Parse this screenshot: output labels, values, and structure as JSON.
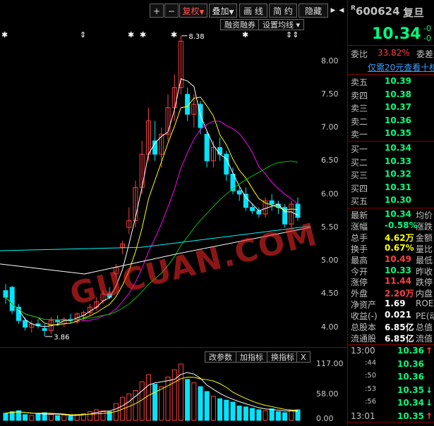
{
  "toolbar": {
    "plus": "+",
    "minus": "−",
    "restore": "复权",
    "overlay": "叠加",
    "draw": "画 线",
    "brief": "简 约",
    "hide": "隐藏"
  },
  "chart_tools": {
    "margin": "融资融券",
    "ma_settings": "设置均线"
  },
  "vol_tools": {
    "edit_params": "改参数",
    "add_indicator": "加指标",
    "switch_indicator": "换指标",
    "close": "X"
  },
  "watermark": "GUCUAN.COM",
  "colors": {
    "up": "#ff4040",
    "down": "#00e5ff",
    "ma5": "#ffffff",
    "ma10": "#ffff00",
    "ma20": "#ff00ff",
    "ma60": "#00c000",
    "ma120": "#00ffff"
  },
  "chart_data": {
    "type": "candlestick",
    "y_ticks": [
      "8.00",
      "7.50",
      "7.00",
      "6.50",
      "6.00",
      "5.50",
      "5.00",
      "4.50",
      "4.00"
    ],
    "ylim": [
      3.7,
      8.6
    ],
    "high_label": "8.38",
    "low_label": "3.86",
    "candles": [
      [
        4.55,
        4.65,
        4.35,
        4.45
      ],
      [
        4.6,
        4.62,
        4.2,
        4.25
      ],
      [
        4.3,
        4.35,
        4.05,
        4.1
      ],
      [
        4.1,
        4.15,
        3.95,
        4.0
      ],
      [
        4.0,
        4.1,
        3.92,
        4.05
      ],
      [
        4.05,
        4.12,
        3.98,
        4.02
      ],
      [
        3.98,
        4.05,
        3.86,
        3.95
      ],
      [
        3.95,
        4.15,
        3.9,
        4.1
      ],
      [
        4.1,
        4.18,
        4.02,
        4.08
      ],
      [
        4.05,
        4.15,
        4.0,
        4.12
      ],
      [
        4.12,
        4.2,
        4.05,
        4.1
      ],
      [
        4.08,
        4.22,
        4.05,
        4.2
      ],
      [
        4.18,
        4.25,
        4.1,
        4.22
      ],
      [
        4.22,
        4.35,
        4.18,
        4.3
      ],
      [
        4.3,
        4.45,
        4.25,
        4.38
      ],
      [
        4.4,
        4.55,
        4.35,
        4.5
      ],
      [
        4.5,
        4.6,
        4.42,
        4.45
      ],
      [
        4.8,
        4.95,
        4.75,
        4.9
      ],
      [
        5.2,
        5.3,
        5.1,
        5.25
      ],
      [
        5.5,
        5.8,
        5.4,
        5.6
      ],
      [
        5.6,
        6.2,
        5.5,
        6.1
      ],
      [
        6.1,
        6.8,
        6.0,
        6.6
      ],
      [
        6.6,
        7.3,
        6.5,
        7.1
      ],
      [
        6.8,
        7.1,
        6.5,
        6.6
      ],
      [
        6.6,
        7.0,
        6.4,
        6.9
      ],
      [
        6.9,
        7.5,
        6.8,
        7.3
      ],
      [
        7.3,
        7.8,
        7.1,
        7.6
      ],
      [
        7.6,
        8.38,
        7.5,
        8.3
      ],
      [
        7.5,
        7.6,
        7.1,
        7.2
      ],
      [
        7.2,
        7.5,
        7.0,
        7.35
      ],
      [
        7.35,
        7.4,
        6.9,
        7.0
      ],
      [
        6.9,
        6.95,
        6.4,
        6.5
      ],
      [
        6.5,
        6.8,
        6.4,
        6.7
      ],
      [
        6.7,
        6.85,
        6.5,
        6.6
      ],
      [
        6.6,
        6.65,
        6.2,
        6.3
      ],
      [
        6.3,
        6.4,
        6.0,
        6.05
      ],
      [
        6.05,
        6.1,
        5.9,
        6.0
      ],
      [
        6.0,
        6.1,
        5.75,
        5.8
      ],
      [
        5.8,
        5.85,
        5.7,
        5.75
      ],
      [
        5.75,
        5.8,
        5.65,
        5.7
      ],
      [
        5.7,
        5.95,
        5.65,
        5.9
      ],
      [
        5.9,
        6.0,
        5.75,
        5.85
      ],
      [
        5.85,
        5.9,
        5.7,
        5.8
      ],
      [
        5.8,
        5.85,
        5.5,
        5.55
      ],
      [
        5.55,
        5.9,
        5.5,
        5.85
      ],
      [
        5.85,
        5.95,
        5.6,
        5.65
      ]
    ]
  },
  "vol_chart": {
    "y_ticks": [
      "117.00",
      "58.00",
      "0.00"
    ],
    "ymax": 117,
    "volumes": [
      15,
      18,
      20,
      12,
      10,
      14,
      16,
      12,
      10,
      11,
      9,
      12,
      14,
      18,
      22,
      20,
      18,
      35,
      48,
      55,
      62,
      80,
      95,
      75,
      70,
      90,
      105,
      117,
      85,
      78,
      70,
      60,
      50,
      45,
      42,
      38,
      30,
      28,
      25,
      22,
      20,
      24,
      18,
      16,
      20,
      22
    ]
  },
  "quote": {
    "code": "600624",
    "name": "复旦",
    "price": "10.34",
    "price_change_sign": "-0",
    "price_change_sign2": "-0",
    "weibi_label": "委比",
    "weibi": "33.82%",
    "weicha_label": "委差",
    "promo": "仅需20元查看十档",
    "sell": [
      {
        "label": "卖五",
        "price": "10.39"
      },
      {
        "label": "卖四",
        "price": "10.38"
      },
      {
        "label": "卖三",
        "price": "10.37"
      },
      {
        "label": "卖二",
        "price": "10.36"
      },
      {
        "label": "卖一",
        "price": "10.35"
      }
    ],
    "buy": [
      {
        "label": "买一",
        "price": "10.34"
      },
      {
        "label": "买二",
        "price": "10.33"
      },
      {
        "label": "买三",
        "price": "10.32"
      },
      {
        "label": "买四",
        "price": "10.31"
      },
      {
        "label": "买五",
        "price": "10.30"
      }
    ],
    "stats": [
      {
        "label": "最新",
        "value": "10.34",
        "color": "#00ff7f",
        "right": "均价"
      },
      {
        "label": "涨幅",
        "value": "-0.58%",
        "color": "#00ff7f",
        "right": "涨跌"
      },
      {
        "label": "总手",
        "value": "4.62万",
        "color": "#ffff00",
        "right": "金额"
      },
      {
        "label": "换手",
        "value": "0.67%",
        "color": "#ffff00",
        "right": "量比"
      },
      {
        "label": "最高",
        "value": "10.49",
        "color": "#ff4040",
        "right": "最低"
      },
      {
        "label": "今开",
        "value": "10.33",
        "color": "#00ff7f",
        "right": "昨收"
      },
      {
        "label": "涨停",
        "value": "11.44",
        "color": "#ff4040",
        "right": "跌停"
      },
      {
        "label": "外盘",
        "value": "2.20万",
        "color": "#ff4040",
        "right": "内盘"
      },
      {
        "label": "净资产",
        "value": "1.69",
        "color": "#ffffff",
        "right": "ROE"
      },
      {
        "label": "收益(-)",
        "value": "0.021",
        "color": "#ffffff",
        "right": "PE(动)"
      },
      {
        "label": "总股本",
        "value": "6.85亿",
        "color": "#ffffff",
        "right": "总值"
      },
      {
        "label": "流通股",
        "value": "6.85亿",
        "color": "#ffffff",
        "right": "流值"
      }
    ],
    "ticks": [
      {
        "time": "13:00",
        "price": "10.36",
        "arrow": "↑",
        "color": "#ff4040"
      },
      {
        "time": ":44",
        "price": "10.36",
        "arrow": "",
        "color": ""
      },
      {
        "time": ":50",
        "price": "10.36",
        "arrow": "",
        "color": ""
      },
      {
        "time": ":53",
        "price": "10.35",
        "arrow": "↓",
        "color": "#00ff7f"
      },
      {
        "time": ":56",
        "price": "10.34",
        "arrow": "↓",
        "color": "#00ff7f"
      },
      {
        "time": "13:01",
        "price": "10.35",
        "arrow": "↑",
        "color": "#ff4040"
      }
    ]
  }
}
